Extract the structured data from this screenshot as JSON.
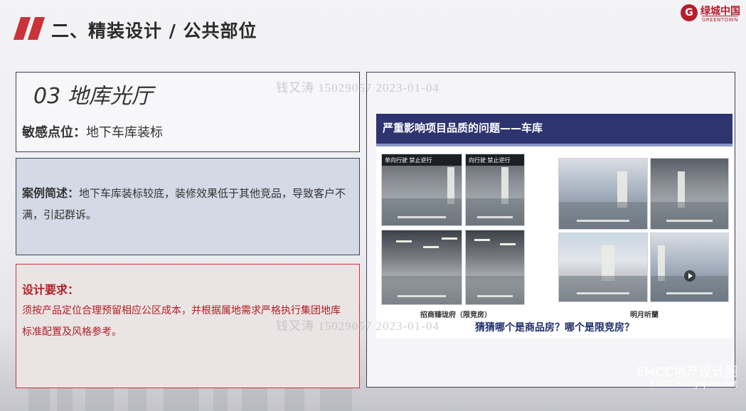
{
  "header": {
    "title": "二、精装设计 / 公共部位",
    "logo_name": "绿城中国",
    "logo_en": "GREENTOWN",
    "logo_mark": "G",
    "accent_color": "#c8343a"
  },
  "section": {
    "number_title": "03  地库光厅",
    "sensitive_label": "敏感点位：",
    "sensitive_value": "地下车库装标"
  },
  "case": {
    "label": "案例简述：",
    "text": "地下车库装标较底，装修效果低于其他竞品，导致客户不满，引起群诉。"
  },
  "requirement": {
    "label": "设计要求：",
    "text": "须按产品定位合理预留相应公区成本，并根据属地需求严格执行集团地库标准配置及风格参考。"
  },
  "panel": {
    "header": "严重影响项目品质的问题——车库",
    "header_color": "#2e3470",
    "sign_1": "单向行驶  禁止逆行",
    "sign_2": "向行驶  禁止逆行",
    "caption_left": "招商臻珑府（限竞房）",
    "caption_right": "明月听蘭",
    "question": "猜猜哪个是商品房？哪个是限竞房？"
  },
  "watermarks": {
    "stamp": "钱又涛 15029057 2023-01-04",
    "site_cn": "EMCC地产设计圈",
    "site_en": "EMCCdesignpart.net"
  }
}
